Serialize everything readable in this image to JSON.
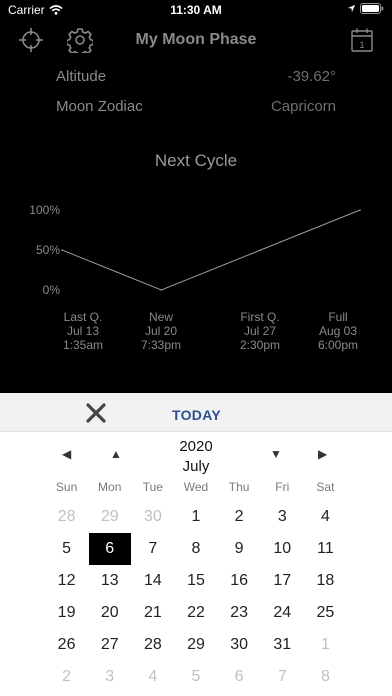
{
  "status": {
    "carrier": "Carrier",
    "time": "11:30 AM"
  },
  "nav": {
    "title": "My Moon Phase",
    "calendar_day": "1"
  },
  "info": [
    {
      "label": "Altitude",
      "value": "-39.62°"
    },
    {
      "label": "Moon Zodiac",
      "value": "Capricorn"
    }
  ],
  "next_cycle_title": "Next Cycle",
  "chart_data": {
    "type": "line",
    "categories": [
      "Last Q.",
      "New",
      "First Q.",
      "Full"
    ],
    "y_ticks": [
      "100%",
      "50%",
      "0%"
    ],
    "ylim": [
      0,
      100
    ],
    "x_days": [
      0,
      7,
      14,
      21
    ],
    "values": [
      50,
      0,
      50,
      100
    ],
    "phases": [
      {
        "name": "Last Q.",
        "date": "Jul 13",
        "time": "1:35am"
      },
      {
        "name": "New",
        "date": "Jul 20",
        "time": "7:33pm"
      },
      {
        "name": "First Q.",
        "date": "Jul 27",
        "time": "2:30pm"
      },
      {
        "name": "Full",
        "date": "Aug 03",
        "time": "6:00pm"
      }
    ]
  },
  "calendar": {
    "today_label": "TODAY",
    "year": "2020",
    "month": "July",
    "weekdays": [
      "Sun",
      "Mon",
      "Tue",
      "Wed",
      "Thu",
      "Fri",
      "Sat"
    ],
    "weeks": [
      [
        {
          "d": "28",
          "o": true
        },
        {
          "d": "29",
          "o": true
        },
        {
          "d": "30",
          "o": true
        },
        {
          "d": "1"
        },
        {
          "d": "2"
        },
        {
          "d": "3"
        },
        {
          "d": "4"
        }
      ],
      [
        {
          "d": "5"
        },
        {
          "d": "6",
          "s": true
        },
        {
          "d": "7"
        },
        {
          "d": "8"
        },
        {
          "d": "9"
        },
        {
          "d": "10"
        },
        {
          "d": "11"
        }
      ],
      [
        {
          "d": "12"
        },
        {
          "d": "13"
        },
        {
          "d": "14"
        },
        {
          "d": "15"
        },
        {
          "d": "16"
        },
        {
          "d": "17"
        },
        {
          "d": "18"
        }
      ],
      [
        {
          "d": "19"
        },
        {
          "d": "20"
        },
        {
          "d": "21"
        },
        {
          "d": "22"
        },
        {
          "d": "23"
        },
        {
          "d": "24"
        },
        {
          "d": "25"
        }
      ],
      [
        {
          "d": "26"
        },
        {
          "d": "27"
        },
        {
          "d": "28"
        },
        {
          "d": "29"
        },
        {
          "d": "30"
        },
        {
          "d": "31"
        },
        {
          "d": "1",
          "o": true
        }
      ],
      [
        {
          "d": "2",
          "o": true
        },
        {
          "d": "3",
          "o": true
        },
        {
          "d": "4",
          "o": true
        },
        {
          "d": "5",
          "o": true
        },
        {
          "d": "6",
          "o": true
        },
        {
          "d": "7",
          "o": true
        },
        {
          "d": "8",
          "o": true
        }
      ]
    ]
  }
}
